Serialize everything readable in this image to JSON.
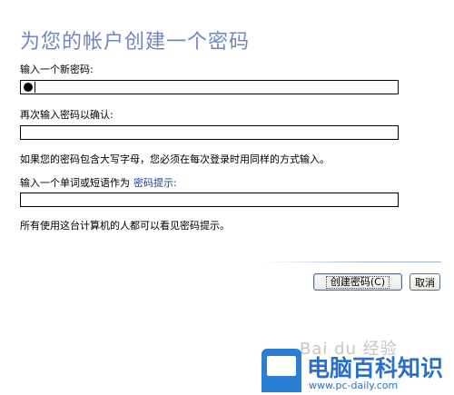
{
  "page": {
    "title": "为您的帐户创建一个密码"
  },
  "new_password": {
    "label": "输入一个新密码:"
  },
  "confirm_password": {
    "label": "再次输入密码以确认:"
  },
  "uppercase_note": "如果您的密码包含大写字母，您必须在每次登录时用同样的方式输入。",
  "hint": {
    "label": "输入一个单词或短语作为",
    "link_text": "密码提示:",
    "note": "所有使用这台计算机的人都可以看见密码提示。"
  },
  "buttons": {
    "create_label": "创建密码(C)",
    "cancel_label": "取消"
  },
  "watermark": {
    "text": "Bai du 经验",
    "badge_title": "电脑百科知识",
    "badge_url": "www.pc-daily.com"
  },
  "colors": {
    "title": "#6f86bf",
    "link": "#1f3f99",
    "badge": "#2a7fd4"
  }
}
